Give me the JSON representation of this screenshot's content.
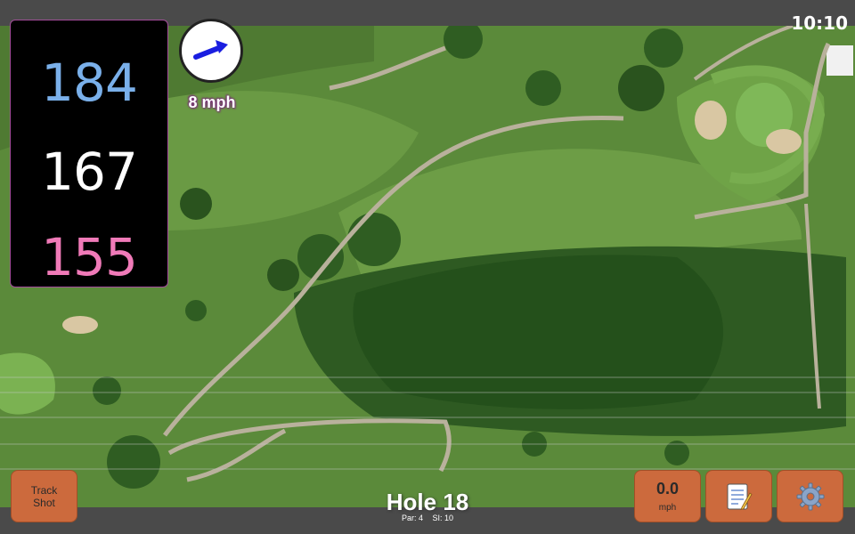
{
  "status": {
    "time": "10:10"
  },
  "distances": {
    "back": "184",
    "middle": "167",
    "front": "155"
  },
  "wind": {
    "speed": "8 mph",
    "direction_icon": "arrow-right-icon"
  },
  "hole": {
    "title": "Hole 18",
    "par": "Par: 4",
    "stroke_index": "SI: 10"
  },
  "buttons": {
    "track_shot": "Track Shot",
    "speed_value": "0.0",
    "speed_unit": "mph",
    "notes_icon": "memo-icon",
    "settings_icon": "gear-icon"
  },
  "colors": {
    "back_distance": "#7ab0ea",
    "middle_distance": "#ffffff",
    "front_distance": "#f07ab8",
    "button": "#cc6a3d",
    "panel_border": "#a34d9a"
  }
}
